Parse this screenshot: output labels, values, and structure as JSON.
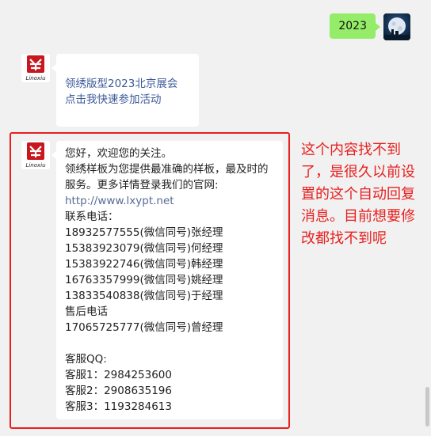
{
  "outgoing": {
    "text": "2023"
  },
  "link_message": {
    "line1": "领绣版型2023北京展会",
    "line2": "点击我快速参加活动"
  },
  "brand": {
    "logo_text": "Linoxiu",
    "brand_color": "#c8171e"
  },
  "reply": {
    "greeting": "您好，欢迎您的关注。",
    "intro": "领绣样板为您提供最准确的样板，最及时的服务。更多详情登录我们的官网: ",
    "url": "http://www.lxypt.net",
    "contact_title": "联系电话：",
    "contacts": [
      "18932577555(微信同号)张经理",
      "15383923079(微信同号)何经理",
      "15383922746(微信同号)韩经理",
      "16763357999(微信同号)姚经理",
      "13833540838(微信同号)于经理"
    ],
    "aftersales_title": "售后电话",
    "aftersales": "17065725777(微信同号)曾经理",
    "qq_title": "客服QQ:",
    "qq": [
      "客服1：2984253600",
      "客服2：2908635196",
      "客服3：1193284613"
    ]
  },
  "annotation": {
    "text": "这个内容找不到了，是很久以前设置的这个自动回复消息。目前想要修改都找不到呢",
    "color": "#e8201f"
  },
  "colors": {
    "outgoing_bubble": "#95ec69",
    "background": "#f1f1f1",
    "link": "#576b95"
  }
}
